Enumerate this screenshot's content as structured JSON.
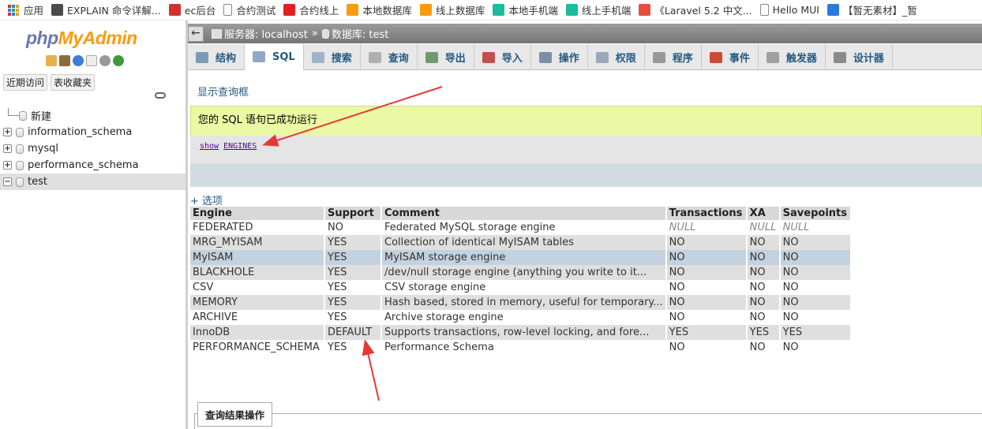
{
  "bookmarks": [
    {
      "label": "应用",
      "icon": "apps-grid-icon"
    },
    {
      "label": "EXPLAIN 命令详解...",
      "icon": "tool-icon",
      "color": "#4a4a4a"
    },
    {
      "label": "ec后台",
      "icon": "red-badge-icon",
      "color": "#d0312d"
    },
    {
      "label": "合约测试",
      "icon": "page-icon",
      "color": "#888888"
    },
    {
      "label": "合约线上",
      "icon": "cart-icon",
      "color": "#e02020"
    },
    {
      "label": "本地数据库",
      "icon": "pma-icon",
      "color": "#f89c0e"
    },
    {
      "label": "线上数据库",
      "icon": "pma-icon",
      "color": "#f89c0e"
    },
    {
      "label": "本地手机端",
      "icon": "mui-icon",
      "color": "#1abc9c"
    },
    {
      "label": "线上手机端",
      "icon": "mui-icon",
      "color": "#1abc9c"
    },
    {
      "label": "《Laravel 5.2 中文...",
      "icon": "laravel-icon",
      "color": "#e74c3c"
    },
    {
      "label": "Hello MUI",
      "icon": "page-icon",
      "color": "#888888"
    },
    {
      "label": "【暂无素材】_暂",
      "icon": "k-icon",
      "color": "#2a7ae2"
    }
  ],
  "sidebar": {
    "logo_a": "php",
    "logo_b": "MyAdmin",
    "tabs": [
      "近期访问",
      "表收藏夹"
    ],
    "tree": [
      {
        "label": "新建",
        "type": "new"
      },
      {
        "label": "information_schema",
        "type": "db"
      },
      {
        "label": "mysql",
        "type": "db"
      },
      {
        "label": "performance_schema",
        "type": "db"
      },
      {
        "label": "test",
        "type": "db",
        "selected": true
      }
    ]
  },
  "breadcrumb": {
    "server": "服务器: localhost",
    "sep": "»",
    "database": "数据库: test"
  },
  "tabs": [
    {
      "label": "结构",
      "icon": "structure-icon",
      "color": "#7a9bb8"
    },
    {
      "label": "SQL",
      "icon": "sql-icon",
      "color": "#8fa7c4",
      "active": true
    },
    {
      "label": "搜索",
      "icon": "search-icon",
      "color": "#9fb3c9"
    },
    {
      "label": "查询",
      "icon": "query-icon",
      "color": "#b0b0b0"
    },
    {
      "label": "导出",
      "icon": "export-icon",
      "color": "#6f9a6f"
    },
    {
      "label": "导入",
      "icon": "import-icon",
      "color": "#c0504d"
    },
    {
      "label": "操作",
      "icon": "wrench-icon",
      "color": "#7b8fa6"
    },
    {
      "label": "权限",
      "icon": "privileges-icon",
      "color": "#9aa8b8"
    },
    {
      "label": "程序",
      "icon": "routines-icon",
      "color": "#999999"
    },
    {
      "label": "事件",
      "icon": "clock-icon",
      "color": "#cc4b37"
    },
    {
      "label": "触发器",
      "icon": "trigger-icon",
      "color": "#a0a0a0"
    },
    {
      "label": "设计器",
      "icon": "designer-icon",
      "color": "#8a8a8a"
    }
  ],
  "show_query_box": "显示查询框",
  "success_message": "您的 SQL 语句已成功运行",
  "sql": {
    "keyword": "show",
    "rest": "ENGINES"
  },
  "options_link": "+ 选项",
  "results": {
    "columns": [
      "Engine",
      "Support",
      "Comment",
      "Transactions",
      "XA",
      "Savepoints"
    ],
    "rows": [
      [
        "FEDERATED",
        "NO",
        "Federated MySQL storage engine",
        "NULL",
        "NULL",
        "NULL"
      ],
      [
        "MRG_MYISAM",
        "YES",
        "Collection of identical MyISAM tables",
        "NO",
        "NO",
        "NO"
      ],
      [
        "MyISAM",
        "YES",
        "MyISAM storage engine",
        "NO",
        "NO",
        "NO"
      ],
      [
        "BLACKHOLE",
        "YES",
        "/dev/null storage engine (anything you write to it...",
        "NO",
        "NO",
        "NO"
      ],
      [
        "CSV",
        "YES",
        "CSV storage engine",
        "NO",
        "NO",
        "NO"
      ],
      [
        "MEMORY",
        "YES",
        "Hash based, stored in memory, useful for temporary...",
        "NO",
        "NO",
        "NO"
      ],
      [
        "ARCHIVE",
        "YES",
        "Archive storage engine",
        "NO",
        "NO",
        "NO"
      ],
      [
        "InnoDB",
        "DEFAULT",
        "Supports transactions, row-level locking, and fore...",
        "YES",
        "YES",
        "YES"
      ],
      [
        "PERFORMANCE_SCHEMA",
        "YES",
        "Performance Schema",
        "NO",
        "NO",
        "NO"
      ]
    ],
    "marked_row": 2
  },
  "query_results_ops": "查询结果操作",
  "colors": {
    "accent": "#235a81",
    "success_bg": "#ebf8a4",
    "annotation_arrow": "#e53935"
  }
}
